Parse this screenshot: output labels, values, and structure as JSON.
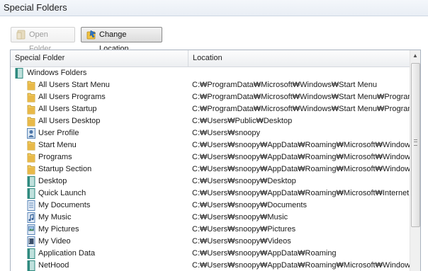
{
  "window": {
    "title": "Special Folders"
  },
  "toolbar": {
    "open_folder_label": "Open Folder",
    "change_location_label": "Change Location"
  },
  "grid": {
    "columns": [
      "Special Folder",
      "Location"
    ],
    "root_label": "Windows Folders",
    "rows": [
      {
        "name": "All Users Start Menu",
        "location": "C:₩ProgramData₩Microsoft₩Windows₩Start Menu",
        "icon": "folder-icon"
      },
      {
        "name": "All Users Programs",
        "location": "C:₩ProgramData₩Microsoft₩Windows₩Start Menu₩Programs",
        "icon": "folder-icon"
      },
      {
        "name": "All Users Startup",
        "location": "C:₩ProgramData₩Microsoft₩Windows₩Start Menu₩Programs₩Startup",
        "icon": "folder-icon"
      },
      {
        "name": "All Users Desktop",
        "location": "C:₩Users₩Public₩Desktop",
        "icon": "folder-icon"
      },
      {
        "name": "User Profile",
        "location": "C:₩Users₩snoopy",
        "icon": "user-profile-icon"
      },
      {
        "name": "Start Menu",
        "location": "C:₩Users₩snoopy₩AppData₩Roaming₩Microsoft₩Windows₩Start Menu",
        "icon": "folder-icon"
      },
      {
        "name": "Programs",
        "location": "C:₩Users₩snoopy₩AppData₩Roaming₩Microsoft₩Windows₩Start Menu₩Programs",
        "icon": "folder-icon"
      },
      {
        "name": "Startup Section",
        "location": "C:₩Users₩snoopy₩AppData₩Roaming₩Microsoft₩Windows₩Start Menu₩Programs₩Startup",
        "icon": "folder-icon"
      },
      {
        "name": "Desktop",
        "location": "C:₩Users₩snoopy₩Desktop",
        "icon": "desktop-icon"
      },
      {
        "name": "Quick Launch",
        "location": "C:₩Users₩snoopy₩AppData₩Roaming₩Microsoft₩Internet Explorer₩Quick Launch",
        "icon": "desktop-icon"
      },
      {
        "name": "My Documents",
        "location": "C:₩Users₩snoopy₩Documents",
        "icon": "documents-icon"
      },
      {
        "name": "My Music",
        "location": "C:₩Users₩snoopy₩Music",
        "icon": "music-icon"
      },
      {
        "name": "My Pictures",
        "location": "C:₩Users₩snoopy₩Pictures",
        "icon": "pictures-icon"
      },
      {
        "name": "My Video",
        "location": "C:₩Users₩snoopy₩Videos",
        "icon": "video-icon"
      },
      {
        "name": "Application Data",
        "location": "C:₩Users₩snoopy₩AppData₩Roaming",
        "icon": "desktop-icon"
      },
      {
        "name": "NetHood",
        "location": "C:₩Users₩snoopy₩AppData₩Roaming₩Microsoft₩Windows₩Network Shortcuts",
        "icon": "desktop-icon"
      }
    ]
  },
  "colors": {
    "folder": "#e8b949",
    "file_blue": "#5a86b8",
    "file_teal": "#2f8a7f"
  }
}
